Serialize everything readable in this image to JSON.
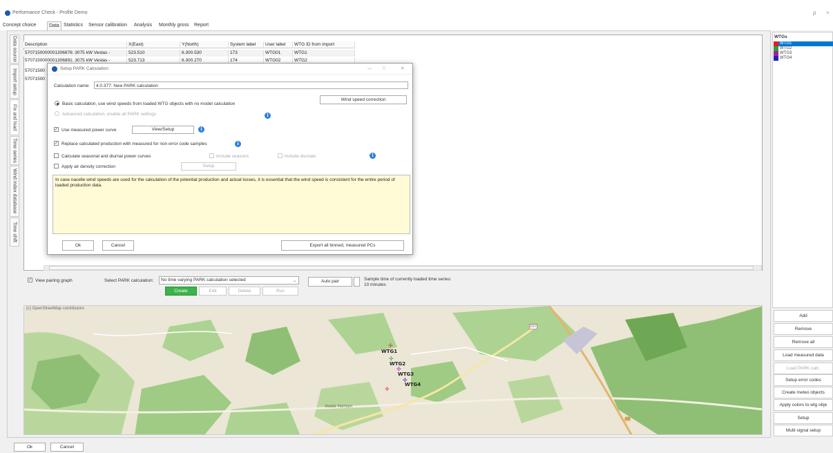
{
  "window": {
    "title": "Performance Check - Profile Demo",
    "min_glyph": "ρ",
    "close_glyph": ">"
  },
  "tabs": [
    "Concept choice",
    "Data",
    "Statistics",
    "Sensor calibration",
    "Analysis",
    "Monthly gross",
    "Report"
  ],
  "active_tab": "Data",
  "side_tabs": [
    "Data source",
    "Import setup",
    "Fix and load",
    "Time series",
    "Wind index database",
    "Time shift"
  ],
  "grid": {
    "headers": [
      "Description",
      "X(East)",
      "Y(North)",
      "System label",
      "User label",
      "WTG ID from import"
    ],
    "rows": [
      [
        "5707150000001306876: 3075 kW Vestas - ",
        "523.510",
        "6.300.530",
        "173",
        "WTG01",
        "WTG1"
      ],
      [
        "5707150000001306891: 3075 kW Vestas - ",
        "523.713",
        "6.300.270",
        "174",
        "WTG02",
        "WTG2"
      ],
      [
        "57071500",
        "",
        "",
        "",
        "",
        ""
      ],
      [
        "57071500",
        "",
        "",
        "",
        "",
        ""
      ]
    ]
  },
  "dialog": {
    "title": "Setup PARK Calculation",
    "calc_name_label": "Calculation name:",
    "calc_name_value": "4.0.377: New PARK calculation",
    "wind_speed_correction": "Wind speed correction",
    "basic_calc": "Basic calculation, use wind speeds from loaded WTG objects with no model calculation",
    "advanced_calc": "Advanced calculation, enable all PARK settings",
    "use_measured_pc": "Use measured power curve",
    "view_setup": "View/Setup",
    "replace_calc": "Replace calculated production with measured for non error code samples",
    "calc_seasonal": "Calculate seasonal and diurnal power curves",
    "include_seasons": "Include seasons",
    "include_diurnals": "Include diurnals",
    "air_density": "Apply air density correction",
    "setup": "Setup",
    "note": "In case nacelle wind speeds are used for the calculation of the potential production and actual losses, it is essential that the wind speed is consistent for the entire period of loaded production data.",
    "ok": "Ok",
    "cancel": "Cancel",
    "export": "Export all binned, measured PCs",
    "win_minimize": "—",
    "win_maximize": "□",
    "win_close": "✕"
  },
  "pairing": {
    "view_graph": "View pairing graph",
    "select_label": "Select PARK calculation:",
    "select_value": "No time varying PARK calculation selected",
    "auto_pair": "Auto pair",
    "sample_time": "Sample time of currently loaded time series: 10 minutes",
    "create": "Create",
    "edit": "Edit",
    "delete": "Delete",
    "run": "Run"
  },
  "map": {
    "attribution": "(c) OpenStreetMap contributors",
    "turbines": [
      "WTG1",
      "WTG2",
      "WTG3",
      "WTG4"
    ],
    "labels": [
      "Vester Hornum",
      "157",
      "29"
    ]
  },
  "wtgs": {
    "header": "WTGs",
    "items": [
      {
        "name": "WTG1",
        "color": "#e02020",
        "selected": true
      },
      {
        "name": "WTG2",
        "color": "#2e9e3a",
        "selected": false
      },
      {
        "name": "WTG3",
        "color": "#a020a0",
        "selected": false
      },
      {
        "name": "WTG4",
        "color": "#2020c0",
        "selected": false
      }
    ]
  },
  "right_buttons": [
    "Add",
    "Remove",
    "Remove all",
    "Load measured data",
    "Load PARK calc.",
    "Setup error codes",
    "Create meteo objects",
    "Apply colors to wtg obje",
    "Setup",
    "Multi signal setup"
  ],
  "footer": {
    "ok": "Ok",
    "cancel": "Cancel"
  },
  "colors": {
    "accent": "#2f7fd9",
    "create_green": "#3cb44b",
    "selection_blue": "#0078d7",
    "note_bg": "#fffbd6"
  }
}
